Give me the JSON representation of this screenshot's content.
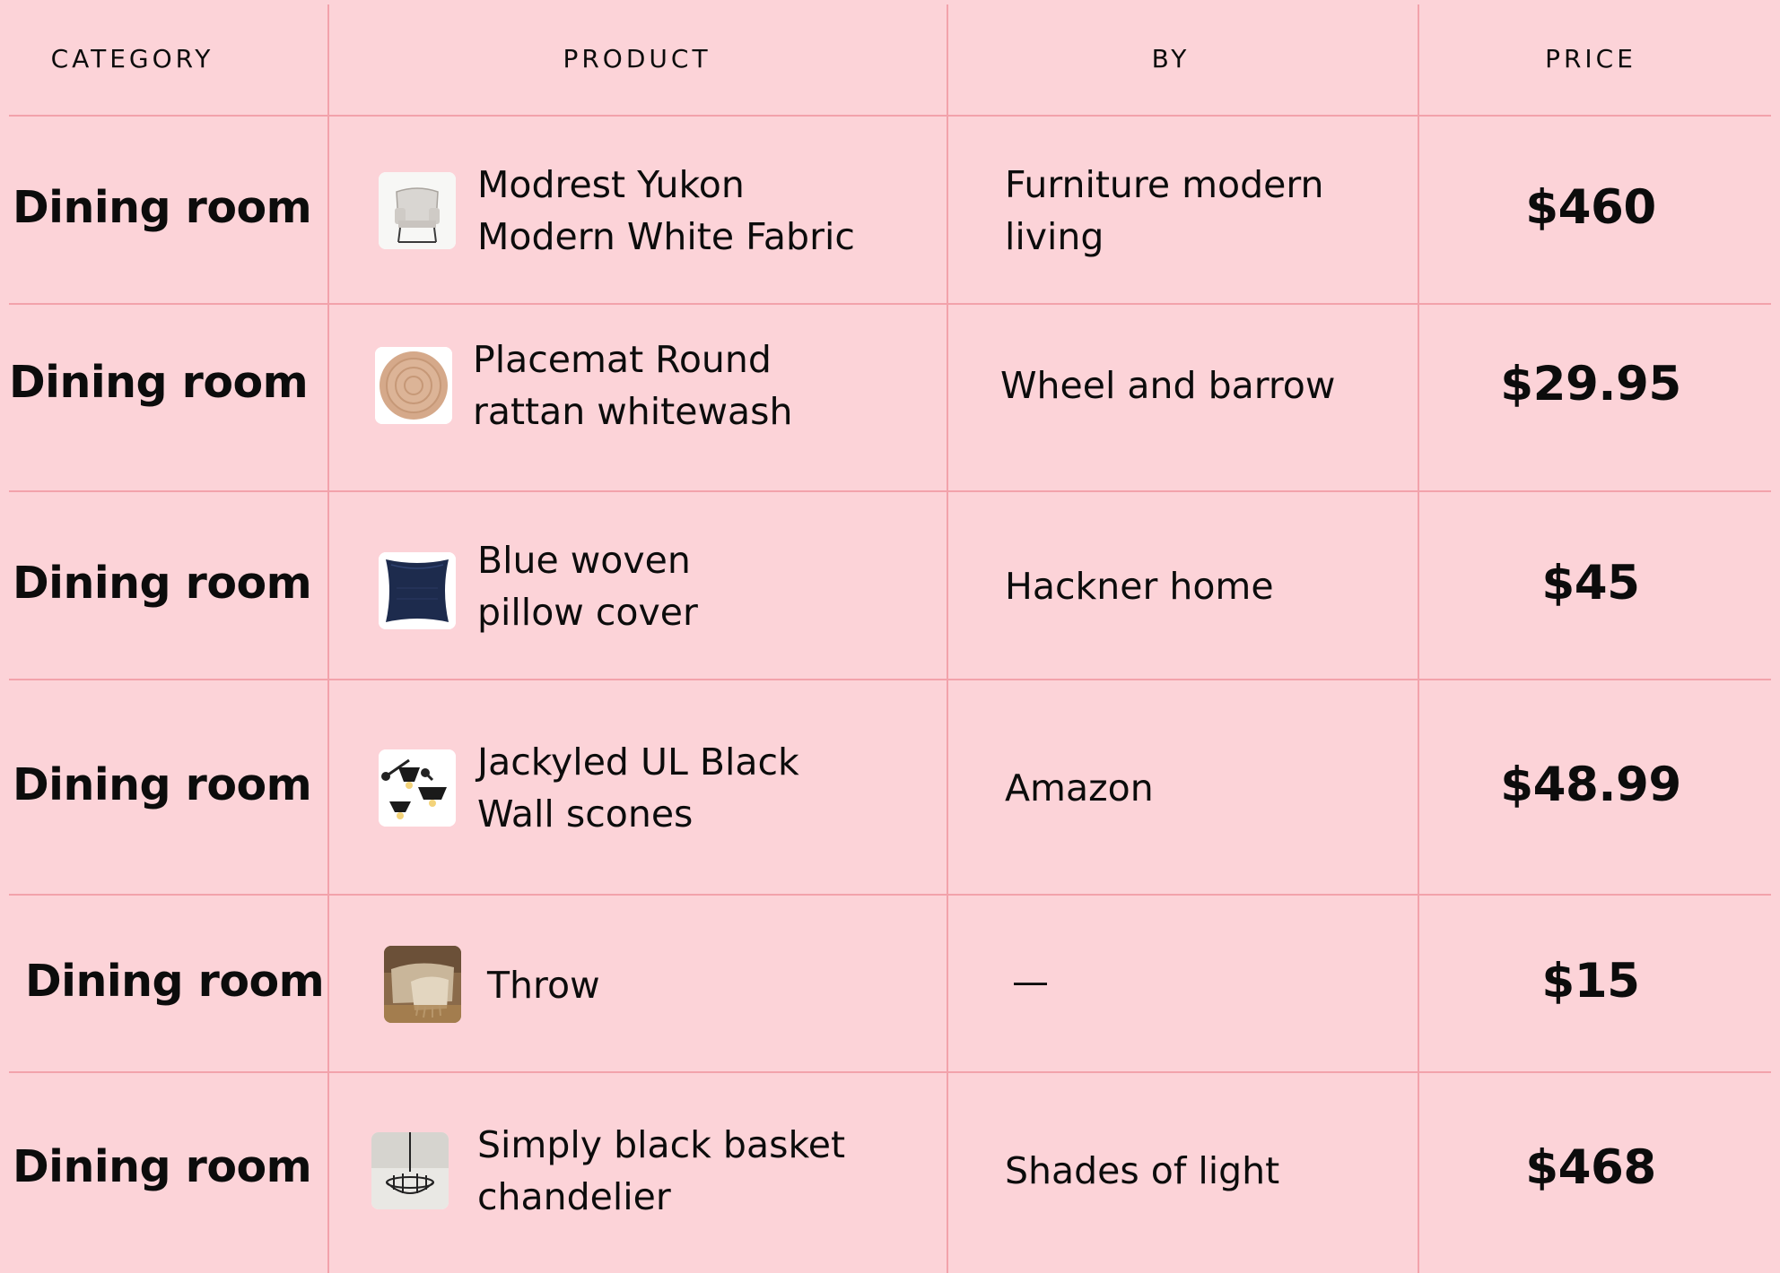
{
  "table": {
    "headers": {
      "category": "CATEGORY",
      "product": "PRODUCT",
      "by": "BY",
      "price": "PRICE"
    },
    "rows": [
      {
        "category": "Dining room",
        "product_line1": "Modrest Yukon",
        "product_line2": "Modern White Fabric",
        "by_line1": "Furniture modern",
        "by_line2": "living",
        "price": "$460",
        "thumb_icon": "chair-icon"
      },
      {
        "category": "Dining room",
        "product_line1": "Placemat Round",
        "product_line2": "rattan whitewash",
        "by_line1": "Wheel and barrow",
        "by_line2": "",
        "price": "$29.95",
        "thumb_icon": "placemat-icon"
      },
      {
        "category": "Dining room",
        "product_line1": "Blue woven",
        "product_line2": "pillow cover",
        "by_line1": "Hackner home",
        "by_line2": "",
        "price": "$45",
        "thumb_icon": "pillow-icon"
      },
      {
        "category": "Dining room",
        "product_line1": "Jackyled UL Black",
        "product_line2": "Wall scones",
        "by_line1": "Amazon",
        "by_line2": "",
        "price": "$48.99",
        "thumb_icon": "wall-sconce-icon"
      },
      {
        "category": "Dining room",
        "product_line1": "Throw",
        "product_line2": "",
        "by_line1": "—",
        "by_line2": "",
        "price": "$15",
        "thumb_icon": "throw-blanket-icon"
      },
      {
        "category": "Dining room",
        "product_line1": "Simply black basket",
        "product_line2": "chandelier",
        "by_line1": "Shades of light",
        "by_line2": "",
        "price": "$468",
        "thumb_icon": "chandelier-icon"
      }
    ]
  },
  "colors": {
    "background": "#fcd3d8",
    "grid_lines": "#f2a2ab",
    "text": "#0c0c0c"
  }
}
